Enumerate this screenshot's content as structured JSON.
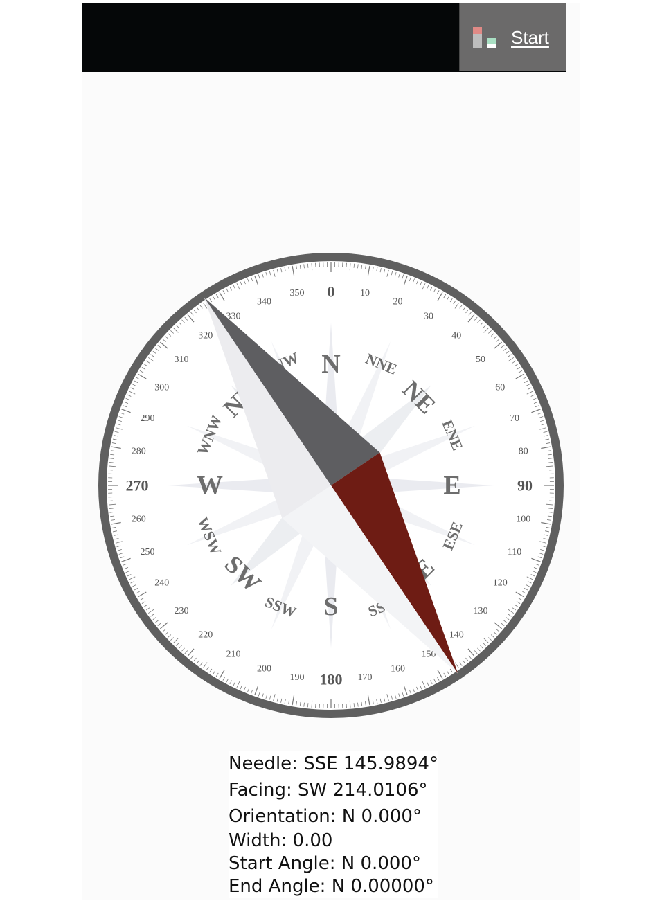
{
  "header": {
    "start_label": "Start",
    "icon": "signal-status-icon"
  },
  "compass": {
    "cardinals": [
      "N",
      "E",
      "S",
      "W"
    ],
    "intercardinals": [
      "NE",
      "SE",
      "SW",
      "NW"
    ],
    "secondary": [
      "NNE",
      "ENE",
      "ESE",
      "SSE",
      "SSW",
      "WSW",
      "WNW",
      "NNW"
    ],
    "major_degree_labels": [
      "0",
      "90",
      "180",
      "270"
    ],
    "minor_degree_labels": [
      "10",
      "20",
      "30",
      "40",
      "50",
      "60",
      "70",
      "80",
      "100",
      "110",
      "120",
      "130",
      "140",
      "150",
      "160",
      "170",
      "190",
      "200",
      "210",
      "220",
      "230",
      "240",
      "250",
      "260",
      "280",
      "290",
      "300",
      "310",
      "320",
      "330",
      "340",
      "350"
    ],
    "needle_angle_deg": 145.9894,
    "colors": {
      "ring": "#5f5f5f",
      "needle_red": "#6e1c14",
      "needle_dark": "#5e5e61",
      "needle_light": "#ececef",
      "rose": "#e6e8ed"
    }
  },
  "readout": {
    "needle": "Needle: SSE 145.9894°",
    "facing": "Facing: SW 214.0106°",
    "orientation": "Orientation: N 0.000°",
    "width": "Width: 0.00",
    "start_angle": "Start Angle: N 0.000°",
    "end_angle": "End Angle: N 0.00000°"
  }
}
